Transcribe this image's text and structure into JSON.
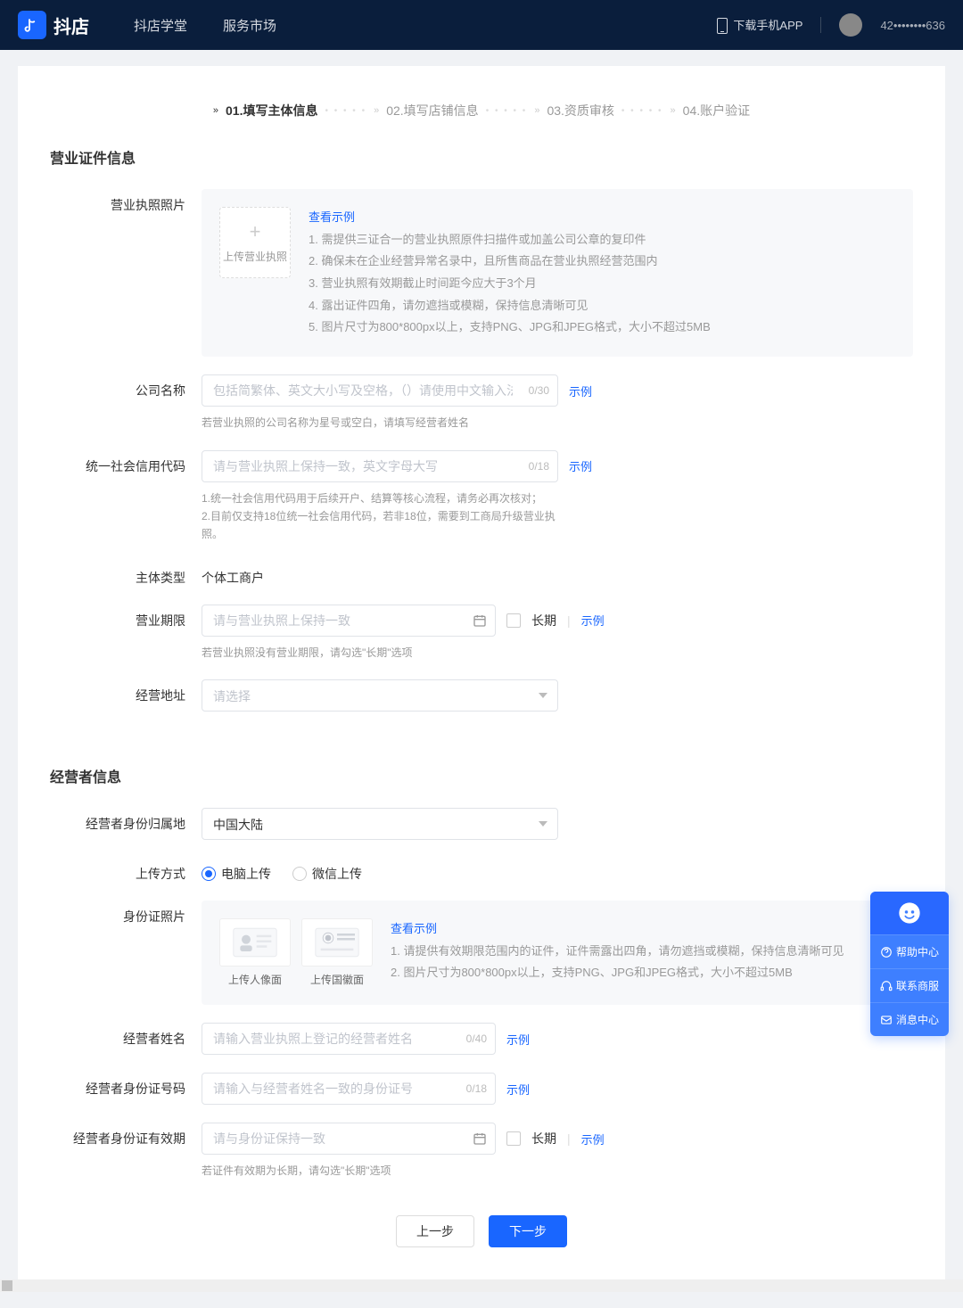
{
  "header": {
    "logo": "抖店",
    "nav": [
      "抖店学堂",
      "服务市场"
    ],
    "downloadApp": "下载手机APP",
    "userId": "42••••••••636"
  },
  "steps": [
    {
      "label": "01.填写主体信息",
      "active": true
    },
    {
      "label": "02.填写店铺信息",
      "active": false
    },
    {
      "label": "03.资质审核",
      "active": false
    },
    {
      "label": "04.账户验证",
      "active": false
    }
  ],
  "sec1": {
    "title": "营业证件信息",
    "license": {
      "label": "营业执照照片",
      "upload": "上传营业执照",
      "viewExample": "查看示例",
      "tips": [
        "1. 需提供三证合一的营业执照原件扫描件或加盖公司公章的复印件",
        "2. 确保未在企业经营异常名录中，且所售商品在营业执照经营范围内",
        "3. 营业执照有效期截止时间距今应大于3个月",
        "4. 露出证件四角，请勿遮挡或模糊，保持信息清晰可见",
        "5. 图片尺寸为800*800px以上，支持PNG、JPG和JPEG格式，大小不超过5MB"
      ]
    },
    "company": {
      "label": "公司名称",
      "placeholder": "包括简繁体、英文大小写及空格，（）请使用中文输入法",
      "counter": "0/30",
      "example": "示例",
      "hint": "若营业执照的公司名称为星号或空白，请填写经营者姓名"
    },
    "uscc": {
      "label": "统一社会信用代码",
      "placeholder": "请与营业执照上保持一致，英文字母大写",
      "counter": "0/18",
      "example": "示例",
      "hint": "1.统一社会信用代码用于后续开户、结算等核心流程，请务必再次核对；\n2.目前仅支持18位统一社会信用代码，若非18位，需要到工商局升级营业执照。"
    },
    "entity": {
      "label": "主体类型",
      "value": "个体工商户"
    },
    "period": {
      "label": "营业期限",
      "placeholder": "请与营业执照上保持一致",
      "long": "长期",
      "example": "示例",
      "hint": "若营业执照没有营业期限，请勾选\"长期\"选项"
    },
    "address": {
      "label": "经营地址",
      "placeholder": "请选择"
    }
  },
  "sec2": {
    "title": "经营者信息",
    "idRegion": {
      "label": "经营者身份归属地",
      "value": "中国大陆"
    },
    "uploadMethod": {
      "label": "上传方式",
      "options": [
        "电脑上传",
        "微信上传"
      ],
      "selected": 0
    },
    "idPhoto": {
      "label": "身份证照片",
      "front": "上传人像面",
      "back": "上传国徽面",
      "viewExample": "查看示例",
      "tips": [
        "1. 请提供有效期限范围内的证件，证件需露出四角，请勿遮挡或模糊，保持信息清晰可见",
        "2. 图片尺寸为800*800px以上，支持PNG、JPG和JPEG格式，大小不超过5MB"
      ]
    },
    "opName": {
      "label": "经营者姓名",
      "placeholder": "请输入营业执照上登记的经营者姓名",
      "counter": "0/40",
      "example": "示例"
    },
    "opId": {
      "label": "经营者身份证号码",
      "placeholder": "请输入与经营者姓名一致的身份证号",
      "counter": "0/18",
      "example": "示例"
    },
    "opIdExp": {
      "label": "经营者身份证有效期",
      "placeholder": "请与身份证保持一致",
      "long": "长期",
      "example": "示例",
      "hint": "若证件有效期为长期，请勾选\"长期\"选项"
    }
  },
  "footer": {
    "prev": "上一步",
    "next": "下一步"
  },
  "help": {
    "items": [
      "帮助中心",
      "联系商服",
      "消息中心"
    ]
  }
}
